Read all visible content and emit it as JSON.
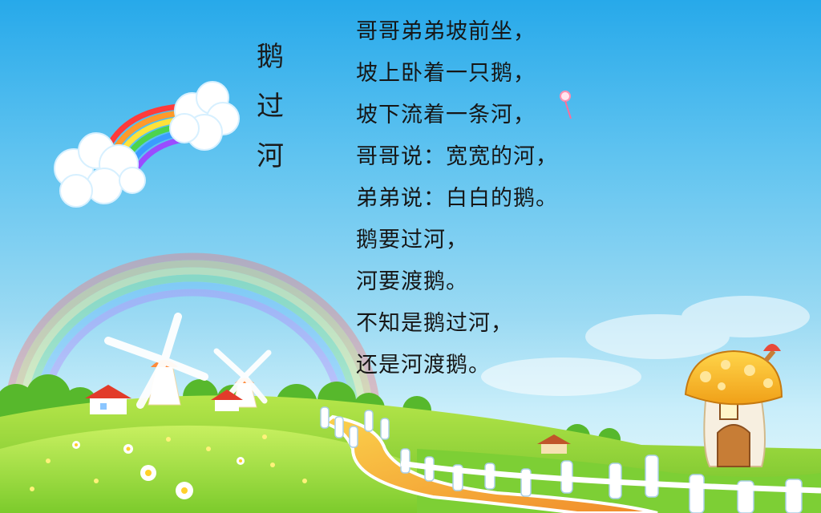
{
  "poem": {
    "title_chars": [
      "鹅",
      "过",
      "河"
    ],
    "lines": [
      "哥哥弟弟坡前坐，",
      "坡上卧着一只鹅，",
      "坡下流着一条河，",
      "哥哥说：宽宽的河，",
      "弟弟说：白白的鹅。",
      "鹅要过河，",
      "河要渡鹅。",
      "不知是鹅过河，",
      "还是河渡鹅。"
    ]
  },
  "colors": {
    "sky_top": "#27a9ea",
    "grass": "#8fd43a",
    "path": "#f2a23a",
    "text": "#161616"
  },
  "decorations": {
    "icons": [
      "rainbow-icon",
      "cloud-icon",
      "windmill-icon",
      "house-icon",
      "mushroom-house-icon",
      "kite-icon",
      "flower-icon",
      "fence-icon"
    ]
  }
}
